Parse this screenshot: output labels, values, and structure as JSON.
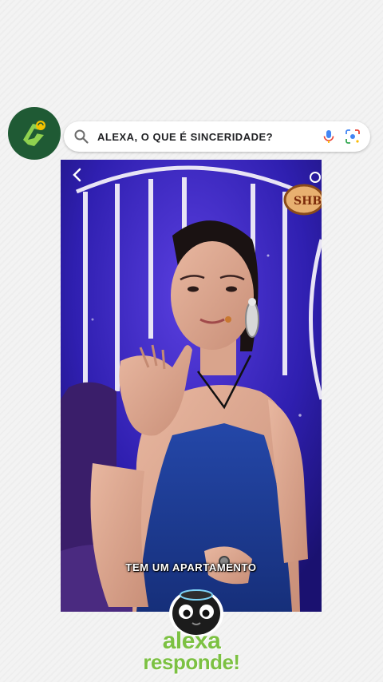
{
  "search": {
    "query": "ALEXA,   O QUE É SINCERIDADE?"
  },
  "video": {
    "subtitle": "TEM UM APARTAMENTO",
    "channel_badge": "SHB"
  },
  "brand": {
    "line1": "alexa",
    "line2": "responde!"
  },
  "icons": {
    "logo": "channel-logo-icon",
    "search": "search-icon",
    "mic": "mic-icon",
    "lens": "lens-icon",
    "back": "chevron-left-icon",
    "mascot": "alexa-mascot-icon"
  },
  "colors": {
    "logo_bg": "#1f5a34",
    "brand_green": "#7cc142",
    "stage_blue": "#2a1a9a",
    "dress_blue": "#1e3a8a"
  }
}
